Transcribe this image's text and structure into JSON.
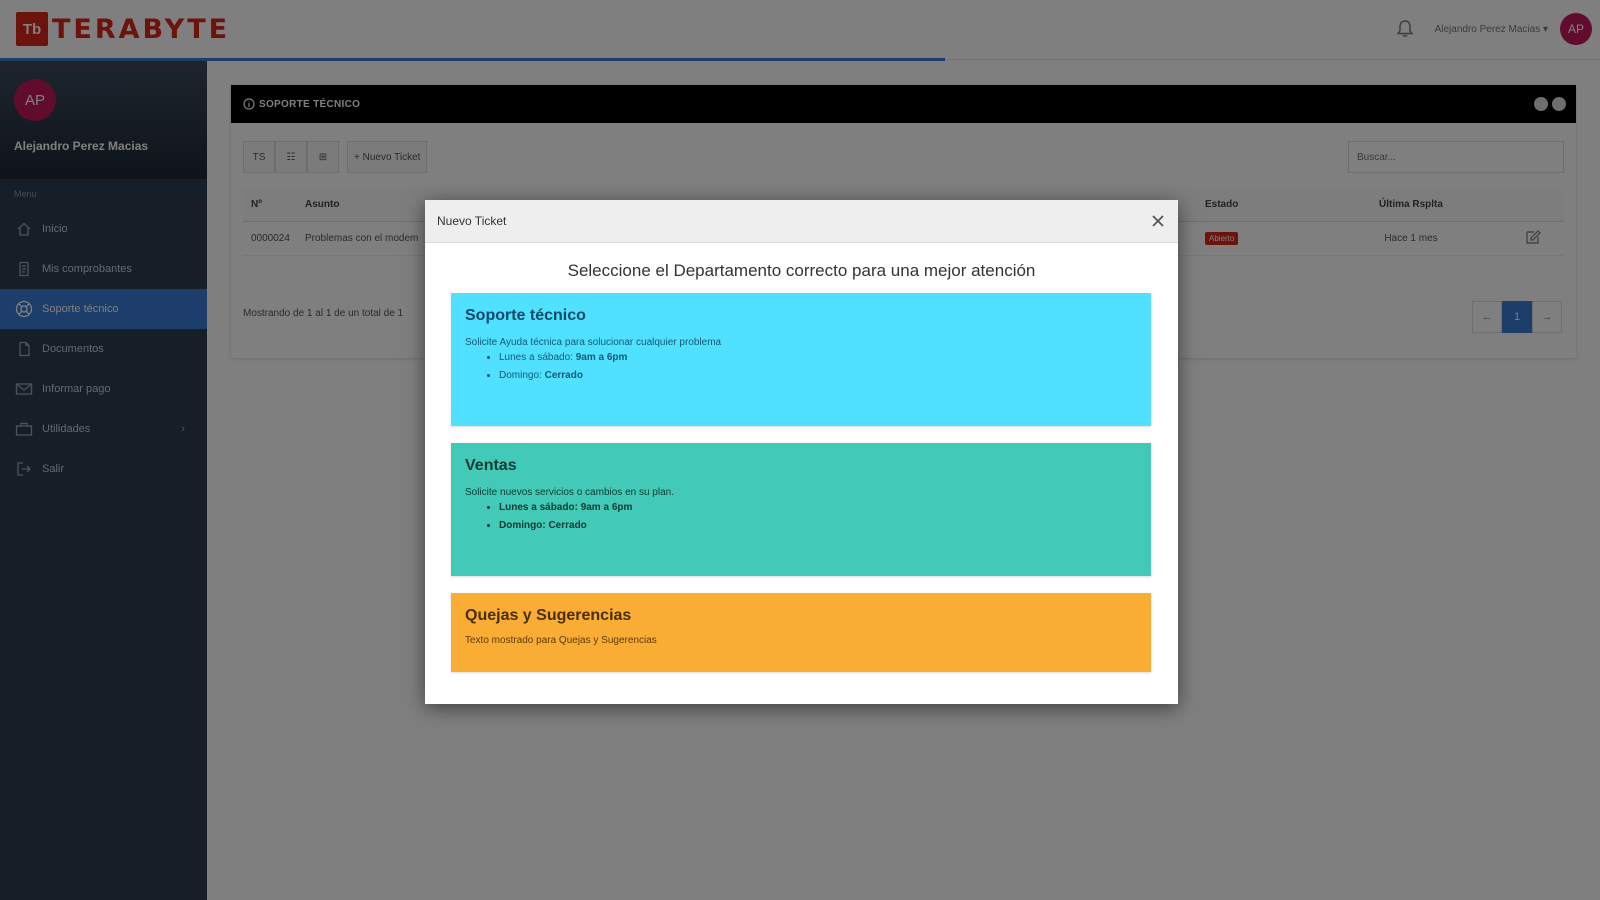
{
  "brand": {
    "mark": "Tb",
    "name": "TERABYTE",
    "accent": "#d9261c"
  },
  "topbar": {
    "username": "Alejandro Perez Macias ▾",
    "avatar_initials": "AP"
  },
  "sidebar": {
    "avatar_initials": "AP",
    "profile_name": "Alejandro Perez Macias",
    "menu_header": "Menu",
    "items": [
      {
        "label": "Inicio",
        "icon": "home-icon"
      },
      {
        "label": "Mis comprobantes",
        "icon": "receipt-icon"
      },
      {
        "label": "Soporte técnico",
        "icon": "support-icon",
        "active": true
      },
      {
        "label": "Documentos",
        "icon": "document-icon"
      },
      {
        "label": "Informar pago",
        "icon": "mail-icon"
      },
      {
        "label": "Utilidades",
        "icon": "tools-icon",
        "has_submenu": true
      },
      {
        "label": "Salir",
        "icon": "logout-icon"
      }
    ]
  },
  "panel": {
    "title": "SOPORTE TÉCNICO",
    "toolbar": {
      "btn1": "TS",
      "btn2": "☷",
      "btn3": "⊞",
      "new_ticket": "+ Nuevo Ticket"
    },
    "search_placeholder": "Buscar...",
    "table": {
      "headers": [
        "Nº",
        "Asunto",
        "Estado",
        "Última Rsplta"
      ],
      "rows": [
        {
          "num": "0000024",
          "subject": "Problemas con el modem",
          "status": "Abierto",
          "last_reply": "Hace 1 mes"
        }
      ]
    },
    "showing": "Mostrando de 1 al 1 de un total de 1",
    "pagination": {
      "prev": "←",
      "page": "1",
      "next": "→"
    }
  },
  "modal": {
    "title": "Nuevo Ticket",
    "subtitle": "Seleccione el Departamento correcto para una mejor atención",
    "departments": [
      {
        "name": "Soporte técnico",
        "description": "Solicite Ayuda técnica para solucionar cualquier problema",
        "hours": [
          {
            "days": "Lunes a sábado:",
            "time": "9am a 6pm"
          },
          {
            "days": "Domingo:",
            "time": "Cerrado"
          }
        ],
        "color": "#4fe1ff"
      },
      {
        "name": "Ventas",
        "description": "Solicite nuevos servicios o cambios en su plan.",
        "hours": [
          {
            "days": "Lunes a sábado:",
            "time": "9am a 6pm"
          },
          {
            "days": "Domingo:",
            "time": "Cerrado"
          }
        ],
        "color": "#43c9b8"
      },
      {
        "name": "Quejas y Sugerencias",
        "description": "Texto mostrado para Quejas y Sugerencias",
        "color": "#f9ad34"
      }
    ]
  }
}
